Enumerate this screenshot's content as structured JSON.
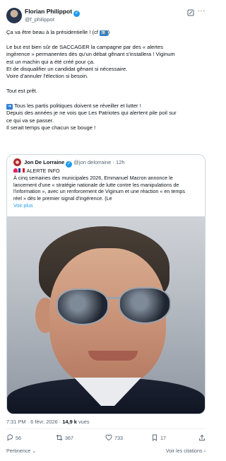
{
  "author": {
    "name": "Florian Philippot",
    "handle": "@f_philippot"
  },
  "tweet": {
    "line1": "Ça va être beau à la présidentielle ! (cf ",
    "line1_emoji": "1️⃣",
    "line1_end": ")",
    "para2": [
      "Le but est bien sûr de SACCAGER la campagne par des « alertes",
      "ingérence » permanentes dès qu'un débat gênant s'installera ! Viginum",
      "est un machin qui a été créé pour ça.",
      "Et de disqualifier un candidat gênant si nécessaire.",
      "Voire d'annuler l'élection si besoin."
    ],
    "para3": "Tout est prêt.",
    "para4_arrow": "➡️",
    "para4": [
      "Tous les partis politiques doivent se réveiller et lutter !",
      "Depuis des années je ne vois que Les Patriotes qui alertent pile poil sur",
      "ce qui va se passer.",
      "Il serait temps que chacun se bouge !"
    ]
  },
  "quote": {
    "name": "Jon De Lorraine",
    "handle": "@jon delorraine",
    "time": "12h",
    "alert": "ALERTE INFO",
    "lines": [
      "À cinq semaines des municipales 2026, Emmanuel Macron annonce le",
      "lancement d'une « stratégie nationale de lutte contre les manipulations de",
      "l'information », avec un renforcement de Viginum et une réaction « en temps",
      "réel » dès le premier signal d'ingérence. (Le"
    ],
    "more": "Voir plus"
  },
  "meta": {
    "time": "7:31 PM",
    "date": "6 févr. 2026",
    "views_count": "14,9 k",
    "views_label": "vues"
  },
  "actions": {
    "replies": "56",
    "reposts": "367",
    "likes": "733",
    "bookmarks": "17"
  },
  "footer": {
    "relevance": "Pertinence ⌄",
    "quotes": "Voir les citations ›"
  },
  "colors": {
    "accent": "#1d9bf0",
    "text": "#0f1419",
    "muted": "#536471"
  }
}
